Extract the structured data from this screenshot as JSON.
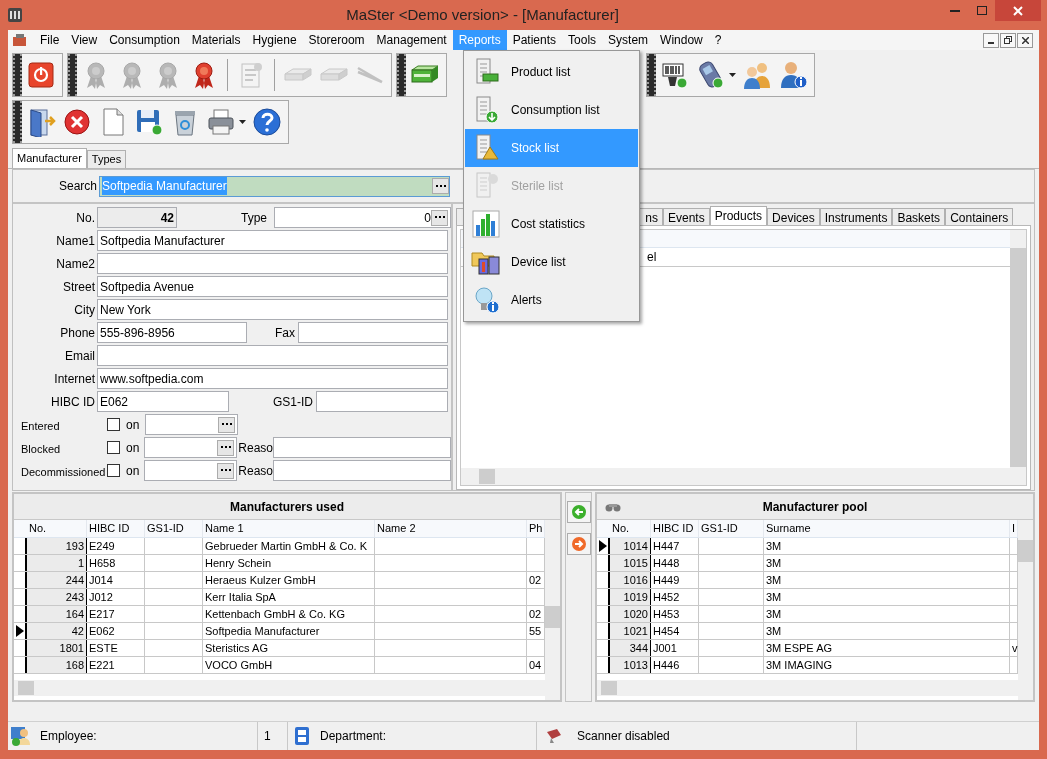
{
  "window": {
    "title": "MaSter <Demo version> - [Manufacturer]"
  },
  "menu_bar": [
    {
      "label": "File",
      "selected": false
    },
    {
      "label": "View",
      "selected": false
    },
    {
      "label": "Consumption",
      "selected": false
    },
    {
      "label": "Materials",
      "selected": false
    },
    {
      "label": "Hygiene",
      "selected": false
    },
    {
      "label": "Storeroom",
      "selected": false
    },
    {
      "label": "Management",
      "selected": false
    },
    {
      "label": "Reports",
      "selected": true
    },
    {
      "label": "Patients",
      "selected": false
    },
    {
      "label": "Tools",
      "selected": false
    },
    {
      "label": "System",
      "selected": false
    },
    {
      "label": "Window",
      "selected": false
    },
    {
      "label": "?",
      "selected": false
    }
  ],
  "reports_menu": [
    {
      "label": "Product list",
      "kind": "product",
      "selected": false,
      "disabled": false
    },
    {
      "label": "Consumption list",
      "kind": "consumption",
      "selected": false,
      "disabled": false
    },
    {
      "label": "Stock list",
      "kind": "stock",
      "selected": true,
      "disabled": false
    },
    {
      "label": "Sterile list",
      "kind": "sterile",
      "selected": false,
      "disabled": true
    },
    {
      "label": "Cost statistics",
      "kind": "chart",
      "selected": false,
      "disabled": false
    },
    {
      "label": "Device list",
      "kind": "devices",
      "selected": false,
      "disabled": false
    },
    {
      "label": "Alerts",
      "kind": "alert",
      "selected": false,
      "disabled": false
    }
  ],
  "toolbar_1": [
    {
      "items": [
        {
          "kind": "power",
          "disabled": false
        }
      ]
    },
    {
      "items": [
        {
          "kind": "ribbon",
          "disabled": true
        },
        {
          "kind": "ribbon",
          "disabled": true
        },
        {
          "kind": "ribbon",
          "disabled": true
        },
        {
          "kind": "ribbon",
          "disabled": false
        },
        {
          "kind": "separator"
        },
        {
          "kind": "clipboard",
          "disabled": true
        },
        {
          "kind": "separator"
        },
        {
          "kind": "tray",
          "disabled": true
        },
        {
          "kind": "tray",
          "disabled": true
        },
        {
          "kind": "forceps",
          "disabled": true
        }
      ]
    },
    {
      "items": [
        {
          "kind": "box",
          "disabled": false
        }
      ]
    },
    {
      "items": [
        {
          "kind": "scanner",
          "disabled": false
        },
        {
          "kind": "device",
          "disabled": false,
          "dropdown": true
        },
        {
          "kind": "people",
          "disabled": false
        },
        {
          "kind": "person_info",
          "disabled": false
        }
      ]
    }
  ],
  "toolbar_2": [
    {
      "kind": "door",
      "disabled": false
    },
    {
      "kind": "cancel",
      "disabled": false
    },
    {
      "kind": "page",
      "disabled": false
    },
    {
      "kind": "save",
      "disabled": false
    },
    {
      "kind": "trash",
      "disabled": false
    },
    {
      "kind": "printer",
      "disabled": false,
      "dropdown": true
    },
    {
      "kind": "help",
      "disabled": false
    }
  ],
  "form_tabs": [
    {
      "label": "Manufacturer",
      "selected": true
    },
    {
      "label": "Types",
      "selected": false
    }
  ],
  "search": {
    "label": "Search",
    "value": "Softpedia Manufacturer"
  },
  "form": {
    "number": {
      "label": "No.",
      "value": "42"
    },
    "type": {
      "label": "Type",
      "value": "0"
    },
    "name1": {
      "label": "Name1",
      "value": "Softpedia Manufacturer"
    },
    "name2": {
      "label": "Name2"
    },
    "street": {
      "label": "Street",
      "value": "Softpedia Avenue"
    },
    "city": {
      "label": "City",
      "value": "New York"
    },
    "phone": {
      "label": "Phone",
      "value": "555-896-8956"
    },
    "fax": {
      "label": "Fax"
    },
    "email": {
      "label": "Email"
    },
    "internet": {
      "label": "Internet",
      "value": "www.softpedia.com"
    },
    "hibc_id": {
      "label": "HIBC ID",
      "value": "E062"
    },
    "gs1_id": {
      "label": "GS1-ID"
    },
    "flags": [
      {
        "label": "Entered",
        "checked": false,
        "on_label": "on"
      },
      {
        "label": "Blocked",
        "checked": false,
        "on_label": "on",
        "reason_label": "Reaso"
      },
      {
        "label": "Decommissioned",
        "checked": false,
        "on_label": "on",
        "reason_label": "Reaso"
      }
    ]
  },
  "detail_tabs": [
    {
      "label": "ns",
      "selected": false
    },
    {
      "label": "Events",
      "selected": false
    },
    {
      "label": "Products",
      "selected": true
    },
    {
      "label": "Devices",
      "selected": false
    },
    {
      "label": "Instruments",
      "selected": false
    },
    {
      "label": "Baskets",
      "selected": false
    },
    {
      "label": "Containers",
      "selected": false
    }
  ],
  "products_list": {
    "rows": [
      {
        "column_1": "el"
      }
    ]
  },
  "used_table": {
    "title": "Manufacturers used",
    "columns": [
      "No.",
      "HIBC ID",
      "GS1-ID",
      "Name 1",
      "Name 2",
      "Ph"
    ],
    "rows": [
      {
        "no": "193",
        "hibc_id": "E249",
        "name_1": "Gebrueder Martin GmbH & Co. K",
        "selected": false
      },
      {
        "no": "1",
        "hibc_id": "H658",
        "name_1": "Henry Schein",
        "selected": false
      },
      {
        "no": "244",
        "hibc_id": "J014",
        "name_1": "Heraeus Kulzer GmbH",
        "column_6": "02",
        "selected": false
      },
      {
        "no": "243",
        "hibc_id": "J012",
        "name_1": "Kerr Italia SpA",
        "selected": false
      },
      {
        "no": "164",
        "hibc_id": "E217",
        "name_1": "Kettenbach GmbH & Co. KG",
        "column_6": "02",
        "selected": false
      },
      {
        "no": "42",
        "hibc_id": "E062",
        "name_1": "Softpedia Manufacturer",
        "column_6": "55",
        "selected": true
      },
      {
        "no": "1801",
        "hibc_id": "ESTE",
        "name_1": "Steristics AG",
        "selected": false
      },
      {
        "no": "168",
        "hibc_id": "E221",
        "name_1": "VOCO GmbH",
        "column_6": "04",
        "selected": false
      }
    ]
  },
  "pool_table": {
    "title": "Manufacturer pool",
    "columns": [
      "No.",
      "HIBC ID",
      "GS1-ID",
      "Surname",
      "I"
    ],
    "rows": [
      {
        "no": "1014",
        "hibc_id": "H447",
        "surname": "3M",
        "selected": true
      },
      {
        "no": "1015",
        "hibc_id": "H448",
        "surname": "3M",
        "selected": false
      },
      {
        "no": "1016",
        "hibc_id": "H449",
        "surname": "3M",
        "selected": false
      },
      {
        "no": "1019",
        "hibc_id": "H452",
        "surname": "3M",
        "selected": false
      },
      {
        "no": "1020",
        "hibc_id": "H453",
        "surname": "3M",
        "selected": false
      },
      {
        "no": "1021",
        "hibc_id": "H454",
        "surname": "3M",
        "selected": false
      },
      {
        "no": "344",
        "hibc_id": "J001",
        "surname": "3M ESPE AG",
        "column_5": "v",
        "selected": false
      },
      {
        "no": "1013",
        "hibc_id": "H446",
        "surname": "3M IMAGING",
        "selected": false
      }
    ]
  },
  "status_bar": {
    "employee_label": "Employee:",
    "employee_value": "1",
    "department_label": "Department:",
    "scanner": "Scanner disabled"
  }
}
